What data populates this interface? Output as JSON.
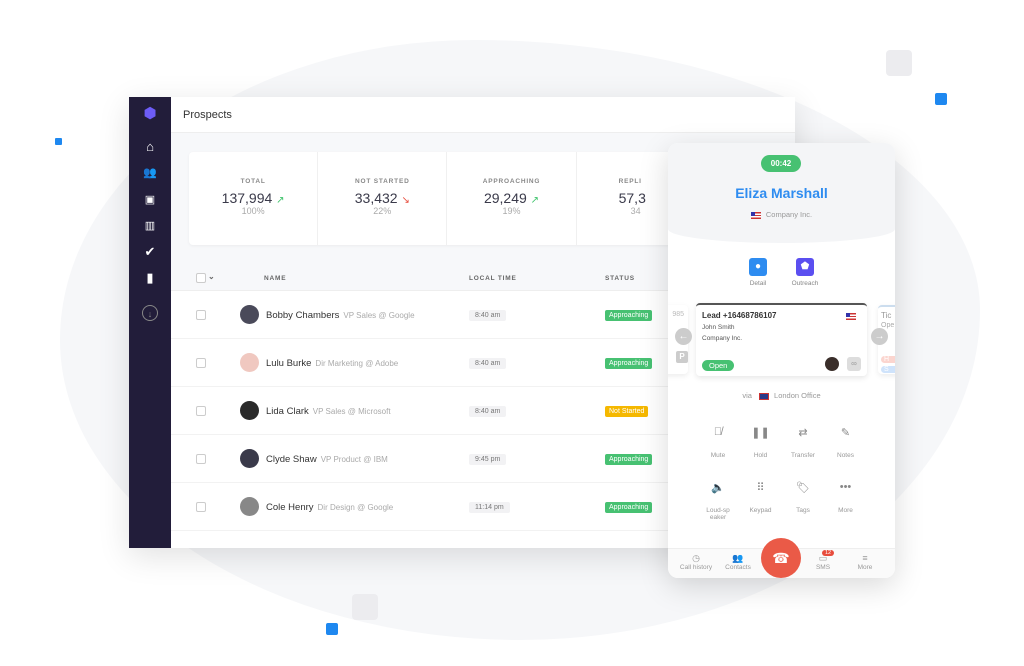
{
  "app": {
    "title": "Prospects"
  },
  "sidebar": {
    "items": [
      "home-icon",
      "people-icon",
      "briefcase-icon",
      "library-icon",
      "check-icon",
      "chart-icon",
      "download-icon"
    ]
  },
  "stats": [
    {
      "label": "TOTAL",
      "value": "137,994",
      "percent": "100%",
      "trend": "up"
    },
    {
      "label": "NOT STARTED",
      "value": "33,432",
      "percent": "22%",
      "trend": "down"
    },
    {
      "label": "APPROACHING",
      "value": "29,249",
      "percent": "19%",
      "trend": "up"
    },
    {
      "label": "REPLI",
      "value": "57,3",
      "percent": "34"
    }
  ],
  "table": {
    "headers": [
      "NAME",
      "LOCAL TIME",
      "STATUS"
    ],
    "rows": [
      {
        "name": "Bobby Chambers",
        "title": "VP Sales @ Google",
        "time": "8:40 am",
        "status": "Approaching"
      },
      {
        "name": "Lulu Burke",
        "title": "Dir Marketing @ Adobe",
        "time": "8:40 am",
        "status": "Approaching"
      },
      {
        "name": "Lida Clark",
        "title": "VP Sales @ Microsoft",
        "time": "8:40 am",
        "status": "Not Started"
      },
      {
        "name": "Clyde Shaw",
        "title": "VP Product @ IBM",
        "time": "9:45 pm",
        "status": "Approaching"
      },
      {
        "name": "Cole Henry",
        "title": "Dir Design @ Google",
        "time": "11:14 pm",
        "status": "Approaching"
      }
    ]
  },
  "colors": {
    "sidebar": "#221d3a",
    "approaching": "#47c172",
    "not_started": "#f5b800",
    "accent": "#2e8cf0",
    "hangup": "#ea5a47"
  },
  "phone": {
    "timer": "00:42",
    "contact_name": "Eliza Marshall",
    "company": "Company Inc.",
    "actions": [
      {
        "label": "Detail",
        "icon": "person-icon"
      },
      {
        "label": "Outreach",
        "icon": "outreach-icon"
      }
    ],
    "card": {
      "title": "Lead +16468786107",
      "name": "John Smith",
      "company": "Company Inc.",
      "status": "Open"
    },
    "left_card_partial": "985",
    "left_chip": "P",
    "right_card_partial": "Tic",
    "right_sub": "Ope",
    "right_chip1": "H",
    "right_chip2": "S",
    "via_label": "via",
    "via_office": "London Office",
    "controls": [
      {
        "label": "Mute",
        "icon": "mic-off-icon"
      },
      {
        "label": "Hold",
        "icon": "pause-icon"
      },
      {
        "label": "Transfer",
        "icon": "transfer-icon"
      },
      {
        "label": "Notes",
        "icon": "pencil-icon"
      },
      {
        "label": "Loud-speaker",
        "icon": "speaker-icon"
      },
      {
        "label": "Keypad",
        "icon": "keypad-icon"
      },
      {
        "label": "Tags",
        "icon": "tag-icon"
      },
      {
        "label": "More",
        "icon": "dots-icon"
      }
    ],
    "nav": [
      {
        "label": "Call history"
      },
      {
        "label": "Contacts"
      },
      {
        "label": "SMS",
        "badge": "12"
      },
      {
        "label": "More"
      }
    ]
  }
}
